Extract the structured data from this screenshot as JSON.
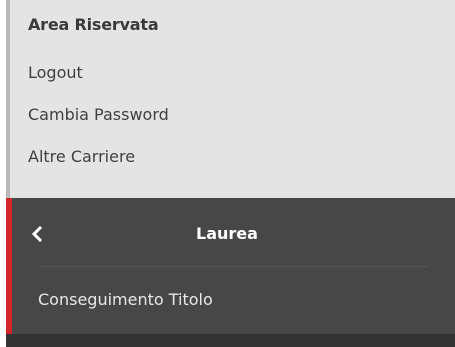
{
  "area_riservata": {
    "title": "Area Riservata",
    "links": [
      "Logout",
      "Cambia Password",
      "Altre Carriere"
    ]
  },
  "submenu": {
    "back_icon": "chevron-left-icon",
    "title": "Laurea",
    "items": [
      "Conseguimento Titolo"
    ]
  },
  "colors": {
    "top_panel_bg": "#e4e4e4",
    "dark_panel_bg": "#474747",
    "accent": "#d3262b"
  }
}
